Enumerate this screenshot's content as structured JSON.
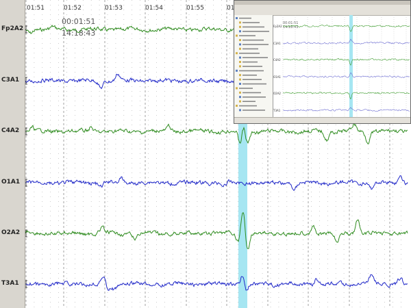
{
  "time_ticks": [
    "01:51",
    "01:52",
    "01:53",
    "01:54",
    "01:55",
    "01:"
  ],
  "timecode": {
    "elapsed": "00:01:51",
    "clock": "14:18:43"
  },
  "channels": [
    "Fp2A2",
    "C3A1",
    "C4A2",
    "O1A1",
    "O2A2",
    "T3A1"
  ],
  "colors": {
    "green": "#2e8b1e",
    "blue": "#2028c8",
    "marker": "#a6e6f2",
    "grid": "#8a8a8a"
  },
  "overview": {
    "elapsed": "00:01:51",
    "clock": "14:18:43",
    "channels": [
      "Fp2A2",
      "C3A1",
      "C4A2",
      "O1A1",
      "O2A2",
      "T3A1"
    ]
  }
}
